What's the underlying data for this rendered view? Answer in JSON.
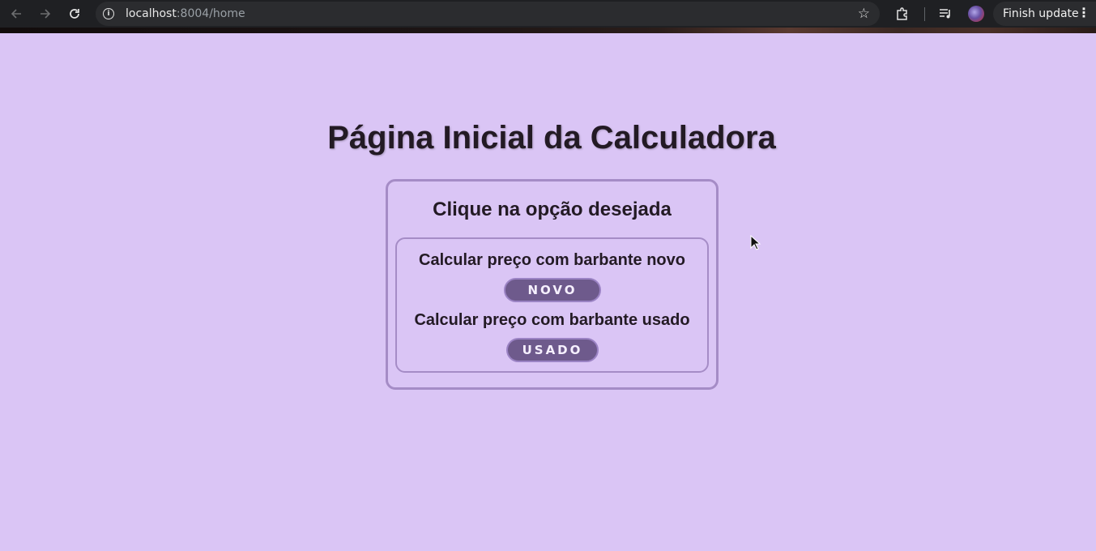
{
  "browser": {
    "url_host": "localhost",
    "url_path": ":8004/home",
    "finish_update_label": "Finish update",
    "icons": [
      "back-arrow-icon",
      "forward-arrow-icon",
      "reload-icon",
      "info-icon",
      "star-icon",
      "extensions-icon",
      "media-icon",
      "profile-avatar",
      "kebab-menu-icon"
    ]
  },
  "page": {
    "title": "Página Inicial da Calculadora",
    "subtitle": "Clique na opção desejada",
    "options": [
      {
        "label": "Calcular preço com barbante novo",
        "button": "NOVO"
      },
      {
        "label": "Calcular preço com barbante usado",
        "button": "USADO"
      }
    ]
  },
  "colors": {
    "background": "#dac5f5",
    "card_border": "#a58cc6",
    "button_fill": "#6e5a8c",
    "text": "#231a24"
  }
}
